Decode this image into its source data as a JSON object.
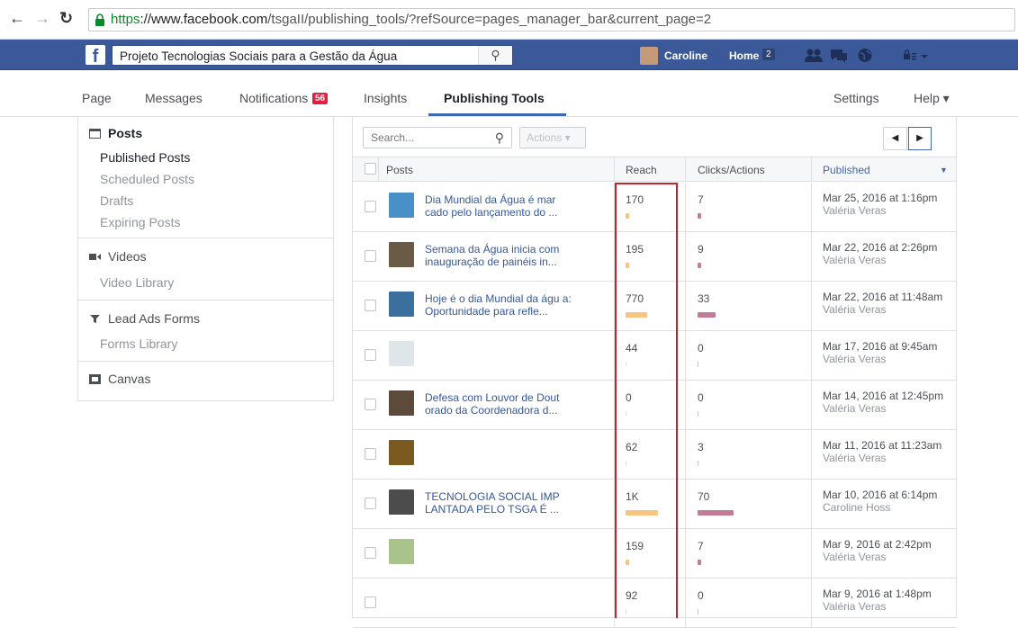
{
  "browser": {
    "back_icon": "arrow-left-icon",
    "url_secure": "https",
    "url_host": "://www.facebook.com",
    "url_path": "/tsgaII/publishing_tools/?refSource=pages_manager_bar&current_page=2"
  },
  "fbbar": {
    "search_value": "Projeto Tecnologias Sociais para a Gestão da Água",
    "user_name": "Caroline",
    "home_label": "Home",
    "home_count": "2"
  },
  "pagenav": {
    "page": "Page",
    "messages": "Messages",
    "notifications": "Notifications",
    "notifications_count": "56",
    "insights": "Insights",
    "publishing_tools": "Publishing Tools",
    "settings": "Settings",
    "help": "Help ▾"
  },
  "sidebar": {
    "posts": "Posts",
    "published": "Published Posts",
    "scheduled": "Scheduled Posts",
    "drafts": "Drafts",
    "expiring": "Expiring Posts",
    "videos": "Videos",
    "video_library": "Video Library",
    "lead_ads": "Lead Ads Forms",
    "forms_library": "Forms Library",
    "canvas": "Canvas"
  },
  "toolbar": {
    "search_placeholder": "Search...",
    "actions": "Actions ▾"
  },
  "table": {
    "headers": {
      "posts": "Posts",
      "reach": "Reach",
      "clicks": "Clicks/Actions",
      "published": "Published"
    },
    "rows": [
      {
        "title": "Dia Mundial da Água é mar cado pelo lançamento do ...",
        "reach": "170",
        "reach_frac": 0.03,
        "clicks": "7",
        "clicks_frac": 0.02,
        "date": "Mar 25, 2016 at 1:16pm",
        "author": "Valéria Veras",
        "thumb": "#4a90c8"
      },
      {
        "title": "Semana da Água inicia com inauguração de painéis in...",
        "reach": "195",
        "reach_frac": 0.03,
        "clicks": "9",
        "clicks_frac": 0.02,
        "date": "Mar 22, 2016 at 2:26pm",
        "author": "Valéria Veras",
        "thumb": "#6b5a45"
      },
      {
        "title": "Hoje é o dia Mundial da águ a: Oportunidade para refle...",
        "reach": "770",
        "reach_frac": 0.6,
        "clicks": "33",
        "clicks_frac": 0.5,
        "date": "Mar 22, 2016 at 11:48am",
        "author": "Valéria Veras",
        "thumb": "#3a6f9e"
      },
      {
        "title": "",
        "reach": "44",
        "reach_frac": 0.0,
        "clicks": "0",
        "clicks_frac": 0.0,
        "date": "Mar 17, 2016 at 9:45am",
        "author": "Valéria Veras",
        "thumb": "#dfe6ea"
      },
      {
        "title": "Defesa com Louvor de Dout orado da Coordenadora d...",
        "reach": "0",
        "reach_frac": 0.0,
        "clicks": "0",
        "clicks_frac": 0.0,
        "date": "Mar 14, 2016 at 12:45pm",
        "author": "Valéria Veras",
        "thumb": "#5c4a3a"
      },
      {
        "title": "",
        "reach": "62",
        "reach_frac": 0.0,
        "clicks": "3",
        "clicks_frac": 0.0,
        "date": "Mar 11, 2016 at 11:23am",
        "author": "Valéria Veras",
        "thumb": "#7a5a20"
      },
      {
        "title": "TECNOLOGIA SOCIAL IMP LANTADA PELO TSGA É ...",
        "reach": "1K",
        "reach_frac": 0.9,
        "clicks": "70",
        "clicks_frac": 1.0,
        "date": "Mar 10, 2016 at 6:14pm",
        "author": "Caroline Hoss",
        "thumb": "#4c4c4c"
      },
      {
        "title": "",
        "reach": "159",
        "reach_frac": 0.03,
        "clicks": "7",
        "clicks_frac": 0.02,
        "date": "Mar 9, 2016 at 2:42pm",
        "author": "Valéria Veras",
        "thumb": "#a8c48a"
      },
      {
        "title": "",
        "reach": "92",
        "reach_frac": 0.0,
        "clicks": "0",
        "clicks_frac": 0.0,
        "date": "Mar 9, 2016 at 1:48pm",
        "author": "Valéria Veras",
        "thumb": ""
      }
    ]
  },
  "colors": {
    "fb_blue": "#3b5998",
    "reach_bar": "#f7c57f",
    "clicks_bar": "#c27c97",
    "highlight": "#c8202d"
  }
}
